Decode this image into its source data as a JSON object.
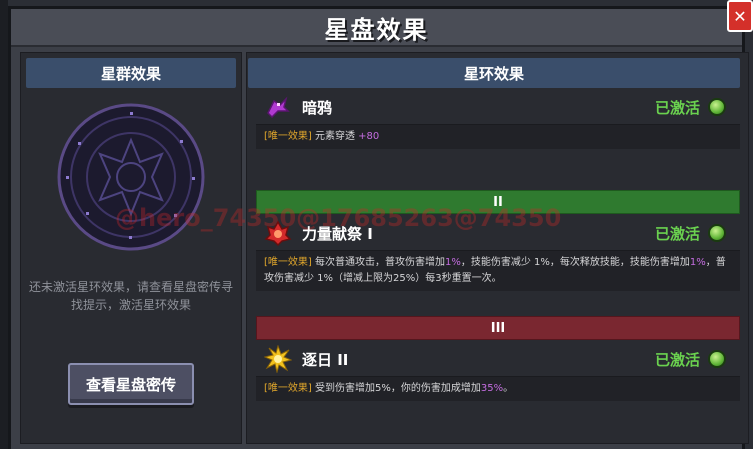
{
  "title": "星盘效果",
  "close_icon": "close-icon",
  "left_panel": {
    "header": "星群效果",
    "hint": "还未激活星环效果，请查看星盘密传寻找提示，激活星环效果",
    "button": "查看星盘密传"
  },
  "right_panel": {
    "header": "星环效果",
    "effects": [
      {
        "icon": "crow-icon",
        "name": "暗鸦",
        "status": "已激活",
        "tag": "[唯一效果]",
        "desc_a": " 元素穿透 ",
        "hl_a": "+80"
      },
      {
        "icon": "fire-sacrifice-icon",
        "name": "力量献祭 I",
        "status": "已激活",
        "tag": "[唯一效果]",
        "desc_a": " 每次普通攻击，普攻伤害增加",
        "hl_a": "1%",
        "desc_b": "，技能伤害减少 1%，每次释放技能，技能伤害增加",
        "hl_b": "1%",
        "desc_c": "，普攻伤害减少 1%（增减上限为25%）每3秒重置一次。"
      },
      {
        "icon": "sun-icon",
        "name": "逐日 II",
        "status": "已激活",
        "tag": "[唯一效果]",
        "desc_a": " 受到伤害增加5%，你的伤害加成增加",
        "hl_a": "35%",
        "desc_b": "。"
      }
    ],
    "tiers": [
      "II",
      "III"
    ]
  },
  "watermark": "@hero_74350@17685263@74350",
  "colors": {
    "active_green": "#6ad14f",
    "tag_orange": "#e0a62b",
    "highlight_purple": "#c46de0",
    "tier2_green": "#2f7a2f",
    "tier3_red": "#7a2730",
    "close_red": "#d4302a"
  }
}
